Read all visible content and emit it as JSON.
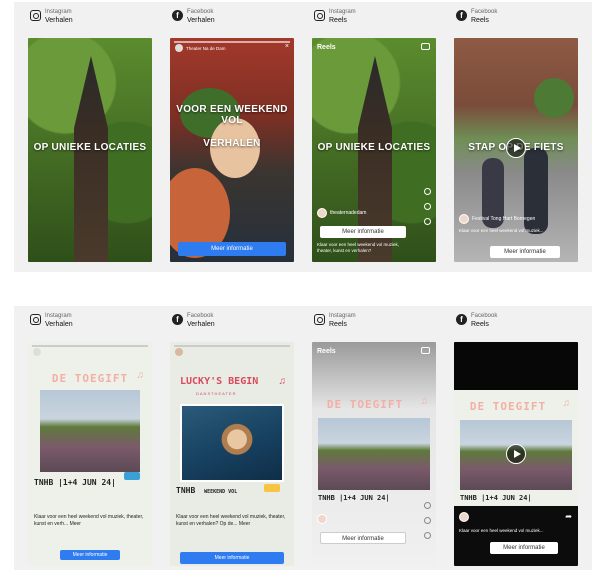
{
  "row1": [
    {
      "platform": "Instagram",
      "format": "Verhalen",
      "icon": "instagram-icon",
      "overlay": "OP UNIEKE LOCATIES"
    },
    {
      "platform": "Facebook",
      "format": "Verhalen",
      "icon": "facebook-icon",
      "overlay_line1": "VOOR EEN WEEKEND VOL",
      "overlay_line2": "VERHALEN",
      "account": "Theater Na de Dam",
      "cta": "Meer informatie"
    },
    {
      "platform": "Instagram",
      "format": "Reels",
      "icon": "instagram-icon",
      "reels_label": "Reels",
      "overlay": "OP UNIEKE LOCATIES",
      "account": "theaternadedam",
      "cta": "Meer informatie",
      "description": "Klaar voor een heel weekend vol muziek, theater, kunst en verhalen?"
    },
    {
      "platform": "Facebook",
      "format": "Reels",
      "icon": "facebook-icon",
      "overlay": "STAP OP DE FIETS",
      "account": "Festival Tong Hart Bornegen",
      "description": "Klaar voor een heel weekend vol muziek...",
      "cta": "Meer informatie"
    }
  ],
  "row2": [
    {
      "platform": "Instagram",
      "format": "Verhalen",
      "icon": "instagram-icon",
      "poster_title": "DE TOEGIFT",
      "logo": "TNHB",
      "dates": "|1+4 JUN 24|",
      "caption": "Klaar voor een heel weekend vol muziek, theater, kunst en verh... Meer",
      "cta": "Meer informatie"
    },
    {
      "platform": "Facebook",
      "format": "Verhalen",
      "icon": "facebook-icon",
      "poster_title": "LUCKY'S BEGIN",
      "poster_sub": "DANSTHEATER",
      "logo": "TNHB",
      "dates": "WEEKEND VOL",
      "caption": "Klaar voor een heel weekend vol muziek, theater, kunst en verhalen? Op de... Meer",
      "cta": "Meer informatie"
    },
    {
      "platform": "Instagram",
      "format": "Reels",
      "icon": "instagram-icon",
      "reels_label": "Reels",
      "poster_title": "DE TOEGIFT",
      "logo": "TNHB",
      "dates": "|1+4 JUN 24|",
      "cta": "Meer informatie"
    },
    {
      "platform": "Facebook",
      "format": "Reels",
      "icon": "facebook-icon",
      "poster_title": "DE TOEGIFT",
      "logo": "TNHB",
      "dates": "|1+4 JUN 24|",
      "caption": "Klaar voor een heel weekend vol muziek...",
      "cta": "Meer informatie"
    }
  ],
  "colors": {
    "cta_blue": "#2f7cf0",
    "poster_pink": "#f2b0a5",
    "lucky_red": "#d94a5f",
    "panel_bg": "#f1f1f1"
  }
}
